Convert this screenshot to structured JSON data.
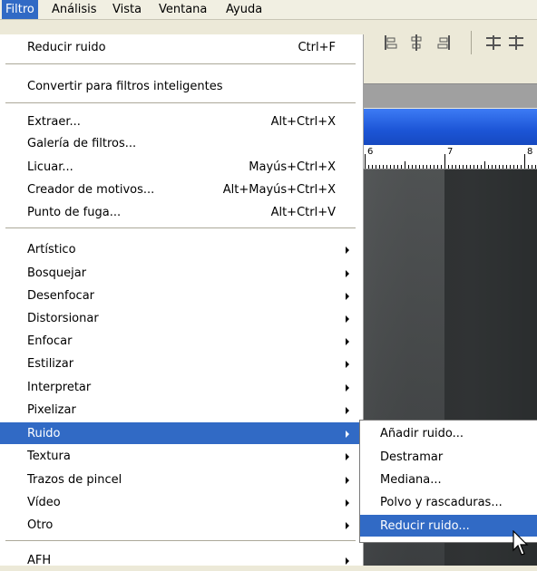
{
  "menubar": {
    "items": [
      {
        "label": "Filtro",
        "active": true
      },
      {
        "label": "Análisis"
      },
      {
        "label": "Vista"
      },
      {
        "label": "Ventana"
      },
      {
        "label": "Ayuda"
      }
    ]
  },
  "menu": {
    "items": [
      {
        "label": "Reducir ruido",
        "shortcut": "Ctrl+F"
      },
      {
        "label": "Convertir para filtros inteligentes"
      },
      {
        "label": "Extraer...",
        "shortcut": "Alt+Ctrl+X"
      },
      {
        "label": "Galería de filtros..."
      },
      {
        "label": "Licuar...",
        "shortcut": "Mayús+Ctrl+X"
      },
      {
        "label": "Creador de motivos...",
        "shortcut": "Alt+Mayús+Ctrl+X"
      },
      {
        "label": "Punto de fuga...",
        "shortcut": "Alt+Ctrl+V"
      },
      {
        "label": "Artístico"
      },
      {
        "label": "Bosquejar"
      },
      {
        "label": "Desenfocar"
      },
      {
        "label": "Distorsionar"
      },
      {
        "label": "Enfocar"
      },
      {
        "label": "Estilizar"
      },
      {
        "label": "Interpretar"
      },
      {
        "label": "Pixelizar"
      },
      {
        "label": "Ruido"
      },
      {
        "label": "Textura"
      },
      {
        "label": "Trazos de pincel"
      },
      {
        "label": "Vídeo"
      },
      {
        "label": "Otro"
      },
      {
        "label": "AFH"
      }
    ]
  },
  "submenu": {
    "items": [
      {
        "label": "Añadir ruido..."
      },
      {
        "label": "Destramar"
      },
      {
        "label": "Mediana..."
      },
      {
        "label": "Polvo y rascaduras..."
      },
      {
        "label": "Reducir ruido..."
      }
    ]
  },
  "ruler": {
    "labels": [
      "6",
      "7",
      "8"
    ]
  },
  "colors": {
    "highlight": "#316ac5",
    "menu_bg": "#ffffff",
    "menubar_bg": "#f1efe2"
  }
}
